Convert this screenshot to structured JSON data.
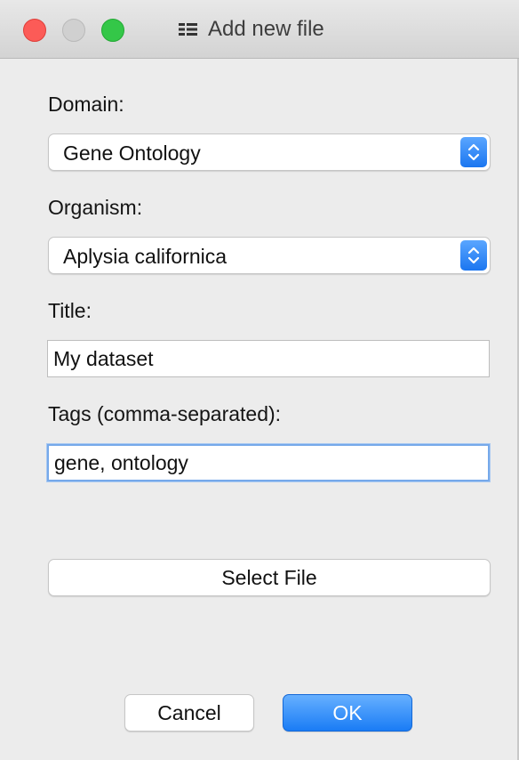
{
  "window": {
    "title": "Add new file",
    "title_icon": "document-icon"
  },
  "form": {
    "domain": {
      "label": "Domain:",
      "value": "Gene Ontology"
    },
    "organism": {
      "label": "Organism:",
      "value": "Aplysia californica"
    },
    "title": {
      "label": "Title:",
      "value": "My dataset"
    },
    "tags": {
      "label": "Tags (comma-separated):",
      "value": "gene, ontology"
    }
  },
  "actions": {
    "select_file": "Select File",
    "cancel": "Cancel",
    "ok": "OK"
  },
  "colors": {
    "accent": "#1a7cf5",
    "close": "#fc5b57",
    "minimize": "#d0d0d0",
    "zoom": "#34c748"
  }
}
